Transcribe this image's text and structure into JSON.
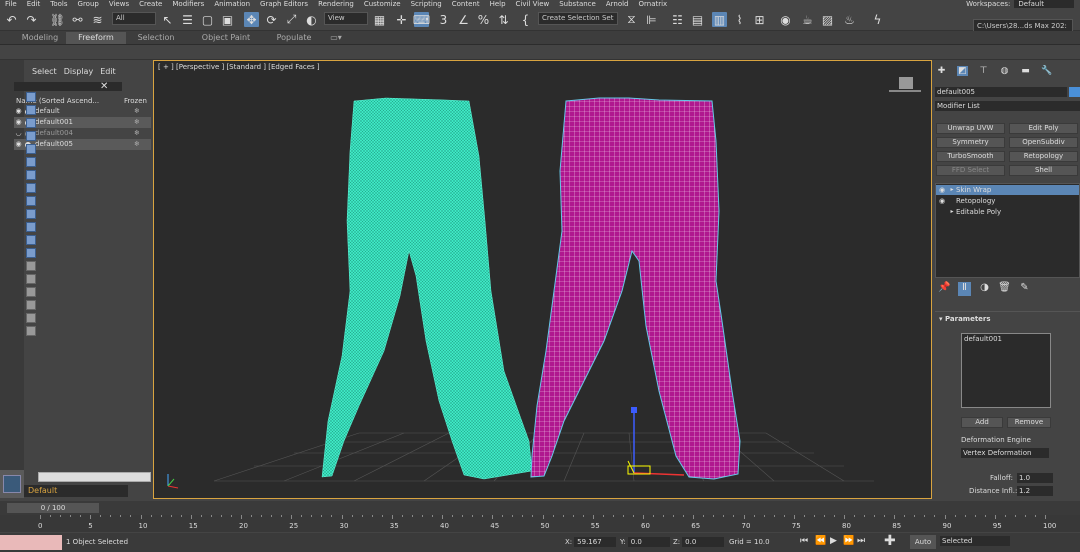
{
  "menu": [
    "File",
    "Edit",
    "Tools",
    "Group",
    "Views",
    "Create",
    "Modifiers",
    "Animation",
    "Graph Editors",
    "Rendering",
    "Customize",
    "Scripting",
    "Content",
    "Help",
    "Civil View",
    "Substance",
    "Arnold",
    "Ornatrix"
  ],
  "workspace": {
    "label": "Workspaces:",
    "value": "Default"
  },
  "toolbar": {
    "selection_filter": "All",
    "ref_coord": "View",
    "selection_set": "Create Selection Set",
    "project_path": "C:\\Users\\28...ds Max 202:"
  },
  "ribbon": {
    "tabs": [
      "Modeling",
      "Freeform",
      "Selection",
      "Object Paint",
      "Populate"
    ],
    "active": "Freeform"
  },
  "explorer": {
    "menu": [
      "Select",
      "Display",
      "Edit"
    ],
    "col_name": "Name (Sorted Ascend...",
    "col_frozen": "Frozen",
    "rows": [
      {
        "name": "default",
        "selected": false,
        "hidden": false
      },
      {
        "name": "default001",
        "selected": true,
        "hidden": false
      },
      {
        "name": "default004",
        "selected": false,
        "hidden": true
      },
      {
        "name": "default005",
        "selected": true,
        "hidden": false
      }
    ],
    "layer": "Default"
  },
  "viewport": {
    "label": "[ + ] [Perspective ] [Standard ] [Edged Faces ]"
  },
  "command_panel": {
    "object_name": "default005",
    "object_color": "#4a90d9",
    "modifier_list": "Modifier List",
    "buttons": [
      {
        "label": "Unwrap UVW",
        "disabled": false
      },
      {
        "label": "Edit Poly",
        "disabled": false
      },
      {
        "label": "Symmetry",
        "disabled": false
      },
      {
        "label": "OpenSubdiv",
        "disabled": false
      },
      {
        "label": "TurboSmooth",
        "disabled": false
      },
      {
        "label": "Retopology",
        "disabled": false
      },
      {
        "label": "FFD Select",
        "disabled": true
      },
      {
        "label": "Shell",
        "disabled": false
      }
    ],
    "stack": [
      {
        "label": "Skin Wrap",
        "selected": true,
        "eye": true,
        "arrow": true
      },
      {
        "label": "Retopology",
        "selected": false,
        "eye": true,
        "arrow": false
      },
      {
        "label": "Editable Poly",
        "selected": false,
        "eye": false,
        "arrow": true
      }
    ],
    "params": {
      "title": "Parameters",
      "target": "default001",
      "add": "Add",
      "remove": "Remove",
      "engine_label": "Deformation Engine",
      "engine_value": "Vertex Deformation",
      "falloff_label": "Falloff:",
      "falloff_value": "1.0",
      "distance_label": "Distance Infl.:",
      "distance_value": "1.2"
    }
  },
  "timeline": {
    "thumb": "0 / 100",
    "ticks": [
      "0",
      "5",
      "10",
      "15",
      "20",
      "25",
      "30",
      "35",
      "40",
      "45",
      "50",
      "55",
      "60",
      "65",
      "70",
      "75",
      "80",
      "85",
      "90",
      "95",
      "100"
    ]
  },
  "status": {
    "text": "1 Object Selected",
    "x_label": "X:",
    "x_value": "59.167",
    "y_label": "Y:",
    "y_value": "0.0",
    "z_label": "Z:",
    "z_value": "0.0",
    "grid": "Grid = 10.0",
    "auto": "Auto",
    "selected": "Selected"
  },
  "colors": {
    "pants_left": "#3ee8c4",
    "pants_right": "#b0188f",
    "accent": "#5b86b5",
    "viewport_border": "#d9a440"
  }
}
